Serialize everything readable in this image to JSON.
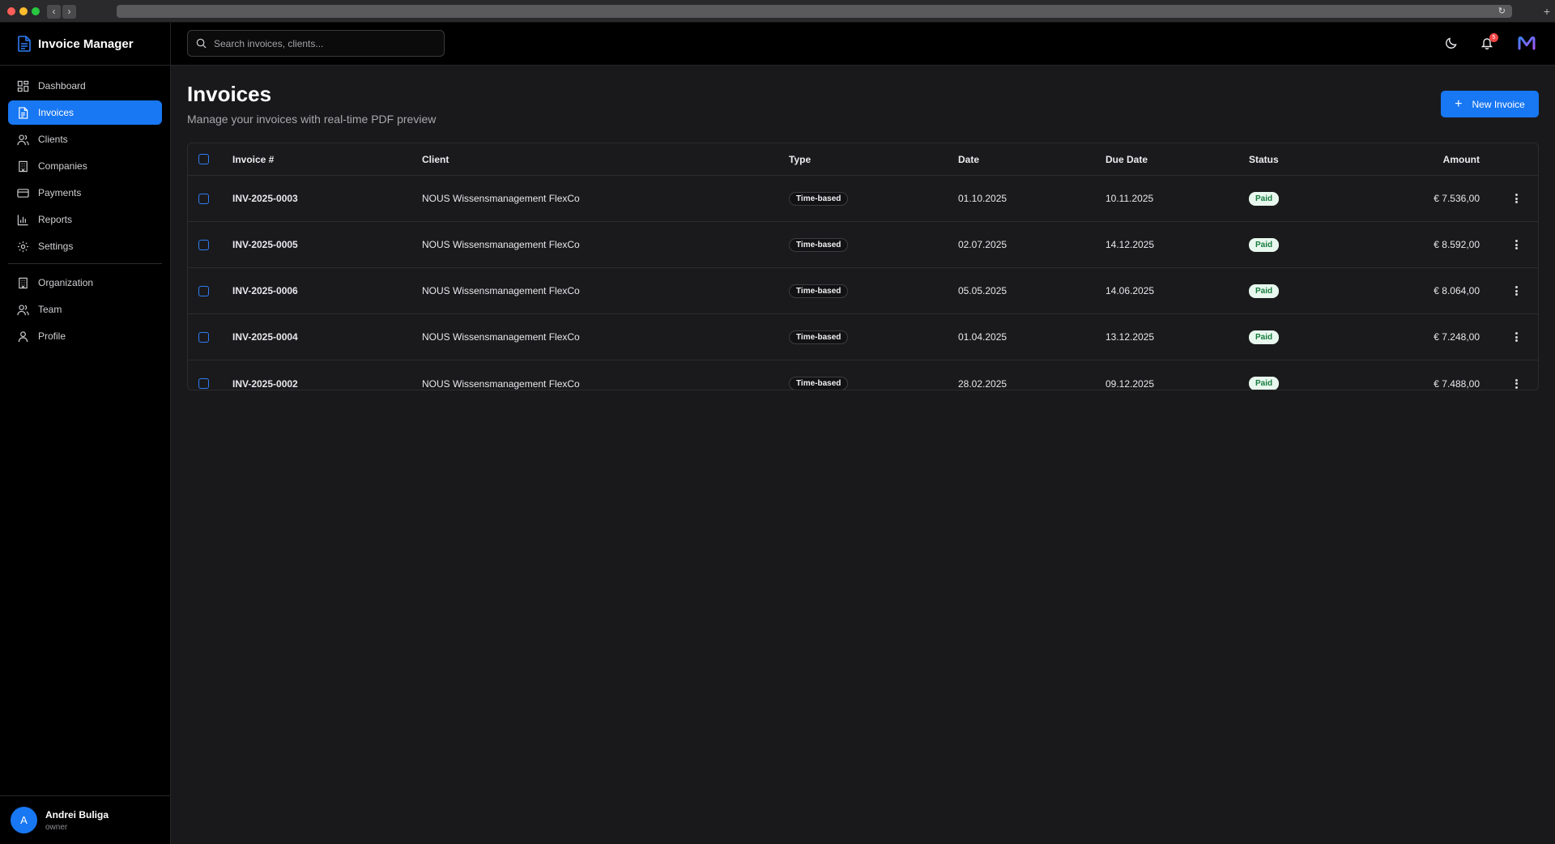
{
  "app": {
    "title": "Invoice Manager"
  },
  "sidebar": {
    "items": [
      {
        "label": "Dashboard",
        "icon": "dashboard-icon"
      },
      {
        "label": "Invoices",
        "icon": "invoice-icon",
        "active": true
      },
      {
        "label": "Clients",
        "icon": "users-icon"
      },
      {
        "label": "Companies",
        "icon": "building-icon"
      },
      {
        "label": "Payments",
        "icon": "credit-card-icon"
      },
      {
        "label": "Reports",
        "icon": "bar-chart-icon"
      },
      {
        "label": "Settings",
        "icon": "gear-icon"
      }
    ],
    "secondary_items": [
      {
        "label": "Organization",
        "icon": "building-icon"
      },
      {
        "label": "Team",
        "icon": "users-icon"
      },
      {
        "label": "Profile",
        "icon": "user-icon"
      }
    ],
    "user": {
      "initial": "A",
      "name": "Andrei Buliga",
      "role": "owner"
    }
  },
  "topbar": {
    "search_placeholder": "Search invoices, clients...",
    "notification_count": "5"
  },
  "page": {
    "title": "Invoices",
    "subtitle": "Manage your invoices with real-time PDF preview",
    "new_button_label": "New Invoice"
  },
  "table": {
    "columns": [
      "Invoice #",
      "Client",
      "Type",
      "Date",
      "Due Date",
      "Status",
      "Amount"
    ],
    "rows": [
      {
        "invoice": "INV-2025-0003",
        "client": "NOUS Wissensmanagement FlexCo",
        "type": "Time-based",
        "date": "01.10.2025",
        "due": "10.11.2025",
        "status": "Paid",
        "amount": "€ 7.536,00"
      },
      {
        "invoice": "INV-2025-0005",
        "client": "NOUS Wissensmanagement FlexCo",
        "type": "Time-based",
        "date": "02.07.2025",
        "due": "14.12.2025",
        "status": "Paid",
        "amount": "€ 8.592,00"
      },
      {
        "invoice": "INV-2025-0006",
        "client": "NOUS Wissensmanagement FlexCo",
        "type": "Time-based",
        "date": "05.05.2025",
        "due": "14.06.2025",
        "status": "Paid",
        "amount": "€ 8.064,00"
      },
      {
        "invoice": "INV-2025-0004",
        "client": "NOUS Wissensmanagement FlexCo",
        "type": "Time-based",
        "date": "01.04.2025",
        "due": "13.12.2025",
        "status": "Paid",
        "amount": "€ 7.248,00"
      },
      {
        "invoice": "INV-2025-0002",
        "client": "NOUS Wissensmanagement FlexCo",
        "type": "Time-based",
        "date": "28.02.2025",
        "due": "09.12.2025",
        "status": "Paid",
        "amount": "€ 7.488,00"
      }
    ]
  },
  "colors": {
    "accent": "#1877f2",
    "background": "#19191b",
    "sidebar": "#000000",
    "paid_badge_bg": "#e8f8ee",
    "paid_badge_text": "#167a3d",
    "notification_badge": "#ef4444"
  }
}
